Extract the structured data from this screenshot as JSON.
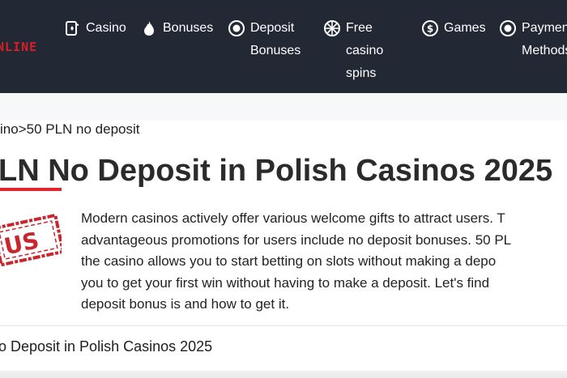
{
  "header": {
    "logo_text": "NLINE",
    "nav": [
      {
        "label": "Casino",
        "icon": "casino-chip-icon"
      },
      {
        "label": "Bonuses",
        "icon": "flame-icon"
      },
      {
        "label": "Deposit\nBonuses",
        "icon": "badge-icon"
      },
      {
        "label": "Free\ncasino\nspins",
        "icon": "wheel-icon"
      },
      {
        "label": "Games",
        "icon": "dollar-coin-icon"
      },
      {
        "label": "Payment\nMethods",
        "icon": "badge-icon"
      }
    ],
    "colors": {
      "background": "#222834",
      "logo": "#d61f26",
      "accent": "#e2252b"
    }
  },
  "breadcrumb": "ino>50 PLN no deposit",
  "title": "LN No Deposit in Polish Casinos 2025",
  "stamp_text": "US",
  "intro_lines": [
    "Modern casinos actively offer various welcome gifts to attract users. T",
    "advantageous promotions for users include no deposit bonuses. 50 PL",
    "the casino allows you to start betting on slots without making a depo",
    "you to get your first win without having to make a deposit. Let's find",
    "deposit bonus is and how to get it."
  ],
  "toc_title": "o Deposit in Polish Casinos 2025"
}
